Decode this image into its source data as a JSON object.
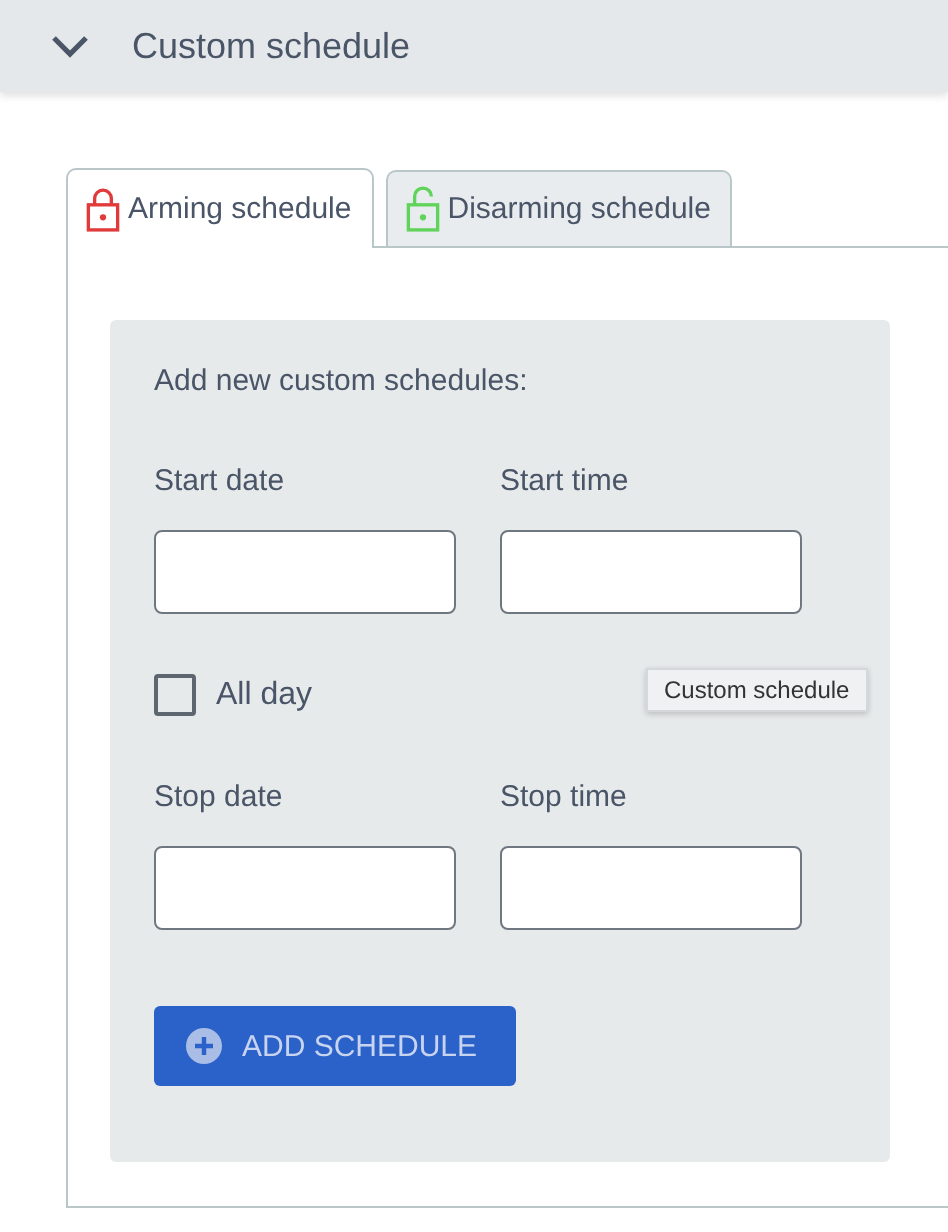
{
  "section": {
    "title": "Custom schedule",
    "expanded": true
  },
  "tabs": [
    {
      "label": "Arming schedule",
      "selected": true,
      "kind": "locked",
      "color": "#e03a3a"
    },
    {
      "label": "Disarming schedule",
      "selected": false,
      "kind": "unlocked",
      "color": "#5fd35a"
    }
  ],
  "form": {
    "heading": "Add new custom schedules:",
    "start_fields": [
      {
        "label": "Start date"
      },
      {
        "label": "Start time"
      }
    ],
    "all_day": {
      "label": "All day",
      "checked": false
    },
    "stop_fields": [
      {
        "label": "Stop date"
      },
      {
        "label": "Stop time"
      }
    ],
    "button": "ADD SCHEDULE"
  },
  "tooltip": "Custom schedule"
}
